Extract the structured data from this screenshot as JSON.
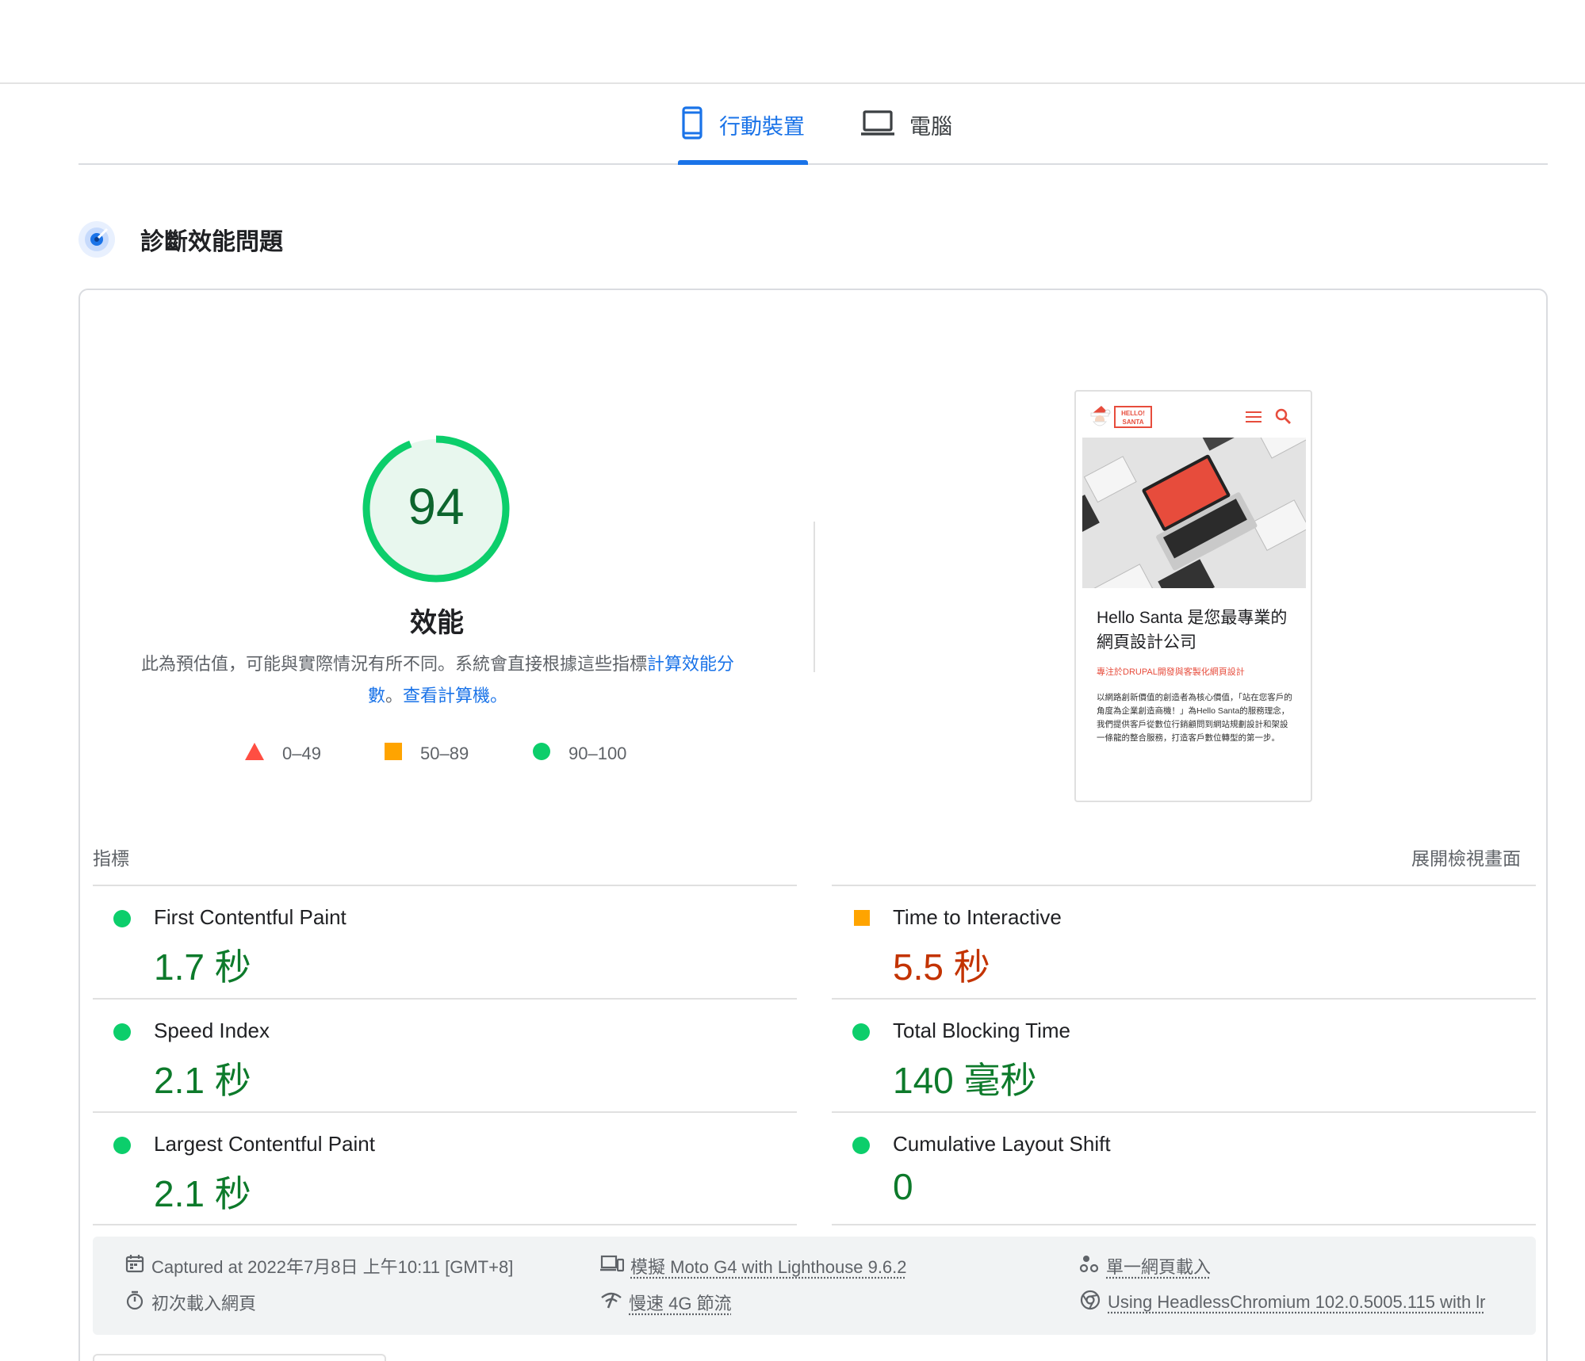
{
  "tabs": {
    "mobile_label": "行動裝置",
    "desktop_label": "電腦"
  },
  "section": {
    "title": "診斷效能問題"
  },
  "performance": {
    "score": "94",
    "score_value": 94,
    "title": "效能",
    "description_prefix": "此為預估值，可能與實際情況有所不同。系統會直接根據這些指標",
    "link_calc": "計算效能分數",
    "sep": "。",
    "link_calculator": "查看計算機。",
    "gauge_color": "#0cce6b",
    "gauge_bg": "#e8f7ee",
    "score_color": "#0d652d"
  },
  "legend": [
    {
      "label": "0–49",
      "shape": "triangle",
      "color": "#ff4e42"
    },
    {
      "label": "50–89",
      "shape": "square",
      "color": "#ffa400"
    },
    {
      "label": "90–100",
      "shape": "circle",
      "color": "#0cce6b"
    }
  ],
  "thumbnail": {
    "logo_text": "HELLO! SANTA",
    "title": "Hello Santa 是您最專業的網頁設計公司",
    "subtitle": "專注於DRUPAL開發與客製化網頁設計",
    "body": "以網路創新價值的創造者為核心價值，「站在您客戶的角度為企業創造商機！」為Hello Santa的服務理念，我們提供客戶從數位行銷顧問到網站規劃設計和架設一條龍的整合服務，打造客戶數位轉型的第一步。"
  },
  "metrics": {
    "heading": "指標",
    "expand": "展開檢視畫面",
    "items": [
      {
        "name": "First Contentful Paint",
        "value": "1.7 秒",
        "status": "good"
      },
      {
        "name": "Time to Interactive",
        "value": "5.5 秒",
        "status": "average"
      },
      {
        "name": "Speed Index",
        "value": "2.1 秒",
        "status": "good"
      },
      {
        "name": "Total Blocking Time",
        "value": "140 毫秒",
        "status": "good"
      },
      {
        "name": "Largest Contentful Paint",
        "value": "2.1 秒",
        "status": "good"
      },
      {
        "name": "Cumulative Layout Shift",
        "value": "0",
        "status": "good"
      }
    ]
  },
  "runtime": {
    "captured": "Captured at 2022年7月8日 上午10:11 [GMT+8]",
    "load_type": "初次載入網頁",
    "device": "模擬 Moto G4 with Lighthouse 9.6.2",
    "network": "慢速 4G 節流",
    "session": "單一網頁載入",
    "browser": "Using HeadlessChromium 102.0.5005.115 with lr"
  },
  "colors": {
    "accent": "#1a73e8",
    "good": "#0cce6b",
    "average": "#ffa400",
    "poor": "#ff4e42"
  }
}
